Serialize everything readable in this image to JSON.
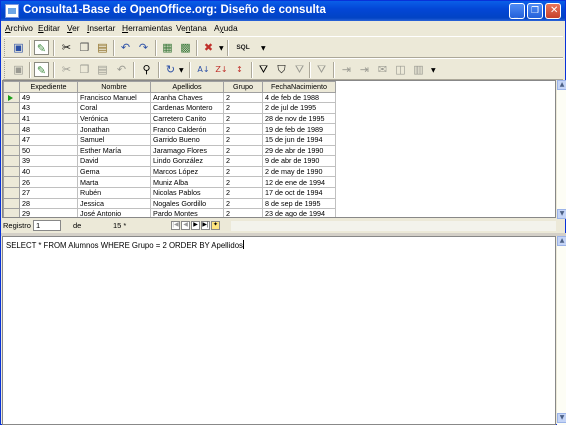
{
  "window": {
    "title": "Consulta1-Base de OpenOffice.org: Diseño de consulta",
    "controls": [
      "minimize",
      "restore",
      "close"
    ]
  },
  "menu": [
    {
      "label": "Archivo",
      "mnemonic": "A"
    },
    {
      "label": "Editar",
      "mnemonic": "E"
    },
    {
      "label": "Ver",
      "mnemonic": "V"
    },
    {
      "label": "Insertar",
      "mnemonic": "I"
    },
    {
      "label": "Herramientas",
      "mnemonic": "H"
    },
    {
      "label": "Ventana",
      "mnemonic": "n"
    },
    {
      "label": "Ayuda",
      "mnemonic": "y"
    }
  ],
  "toolbar1_icons": [
    "save-icon",
    "edit-design-icon",
    "cut-icon",
    "copy-icon",
    "paste-icon",
    "undo-icon",
    "redo-icon",
    "add-table-icon",
    "switch-design-view-icon",
    "delete-icon",
    "run-query-icon"
  ],
  "toolbar1_labels": {
    "run_query": "SQL"
  },
  "toolbar2_icons": [
    "save-record-icon",
    "edit-data-icon",
    "cut-icon",
    "copy-icon",
    "paste-icon",
    "undo-icon",
    "find-record-icon",
    "refresh-icon",
    "sort-ascending-icon",
    "sort-descending-icon",
    "autofilter-icon",
    "standard-filter-icon",
    "remove-filter-icon",
    "data-to-text-icon",
    "data-to-fields-icon",
    "mail-merge-icon",
    "data-source-icon",
    "explorer-icon"
  ],
  "grid": {
    "columns": [
      "Expediente",
      "Nombre",
      "Apellidos",
      "Grupo",
      "FechaNacimiento"
    ],
    "rows": [
      [
        "49",
        "Francisco Manuel",
        "Aranha Chaves",
        "2",
        "4 de feb de 1988"
      ],
      [
        "43",
        "Coral",
        "Cardenas Montero",
        "2",
        "2 de jul de 1995"
      ],
      [
        "41",
        "Verónica",
        "Carretero Canito",
        "2",
        "28 de nov de 1995"
      ],
      [
        "48",
        "Jonathan",
        "Franco Calderón",
        "2",
        "19 de feb de 1989"
      ],
      [
        "47",
        "Samuel",
        "Garrido Bueno",
        "2",
        "15 de jun de 1994"
      ],
      [
        "50",
        "Esther María",
        "Jaramago Flores",
        "2",
        "29 de abr de 1990"
      ],
      [
        "39",
        "David",
        "Lindo González",
        "2",
        "9 de abr de 1990"
      ],
      [
        "40",
        "Gema",
        "Marcos López",
        "2",
        "2 de may de 1990"
      ],
      [
        "26",
        "Marta",
        "Muniz Alba",
        "2",
        "12 de ene de 1994"
      ],
      [
        "27",
        "Rubén",
        "Nicolas Pablos",
        "2",
        "17 de oct de 1994"
      ],
      [
        "28",
        "Jessica",
        "Nogales Gordillo",
        "2",
        "8 de sep de 1995"
      ],
      [
        "29",
        "José Antonio",
        "Pardo Montes",
        "2",
        "23 de ago de 1994"
      ]
    ],
    "current_row_index": 0
  },
  "navigation": {
    "record_label": "Registro",
    "record_value": "1",
    "of_label": "de",
    "total": "15 *",
    "buttons": [
      "first-record",
      "previous-record",
      "next-record",
      "last-record",
      "new-record"
    ]
  },
  "sql": {
    "text": "SELECT * FROM Alumnos WHERE Grupo = 2 ORDER BY Apellidos"
  },
  "colors": {
    "title_bar": "#0346d6",
    "chrome": "#ece9d8",
    "current_record_marker": "#1a9e1a"
  }
}
